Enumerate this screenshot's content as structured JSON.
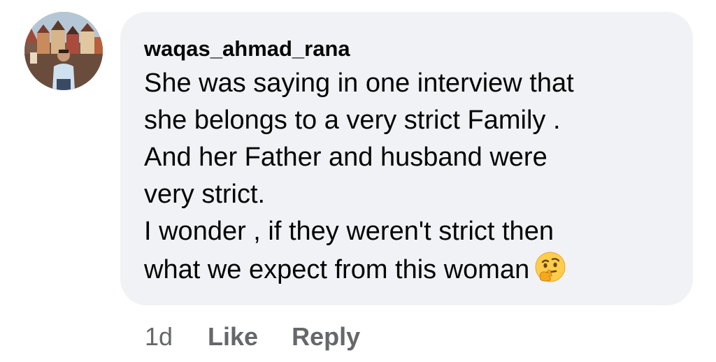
{
  "comment": {
    "author": "waqas_ahmad_rana",
    "lines": [
      "She was saying in one interview that",
      "she belongs to a very strict Family .",
      "And her Father and husband were",
      "very strict.",
      "I wonder , if they weren't strict then",
      "what we expect from this woman"
    ],
    "emoji_icon": "thinking-face-icon",
    "timestamp": "1d",
    "like_label": "Like",
    "reply_label": "Reply"
  },
  "colors": {
    "bubble_bg": "#f0f2f5",
    "meta_text": "#65676b",
    "text": "#050505"
  }
}
